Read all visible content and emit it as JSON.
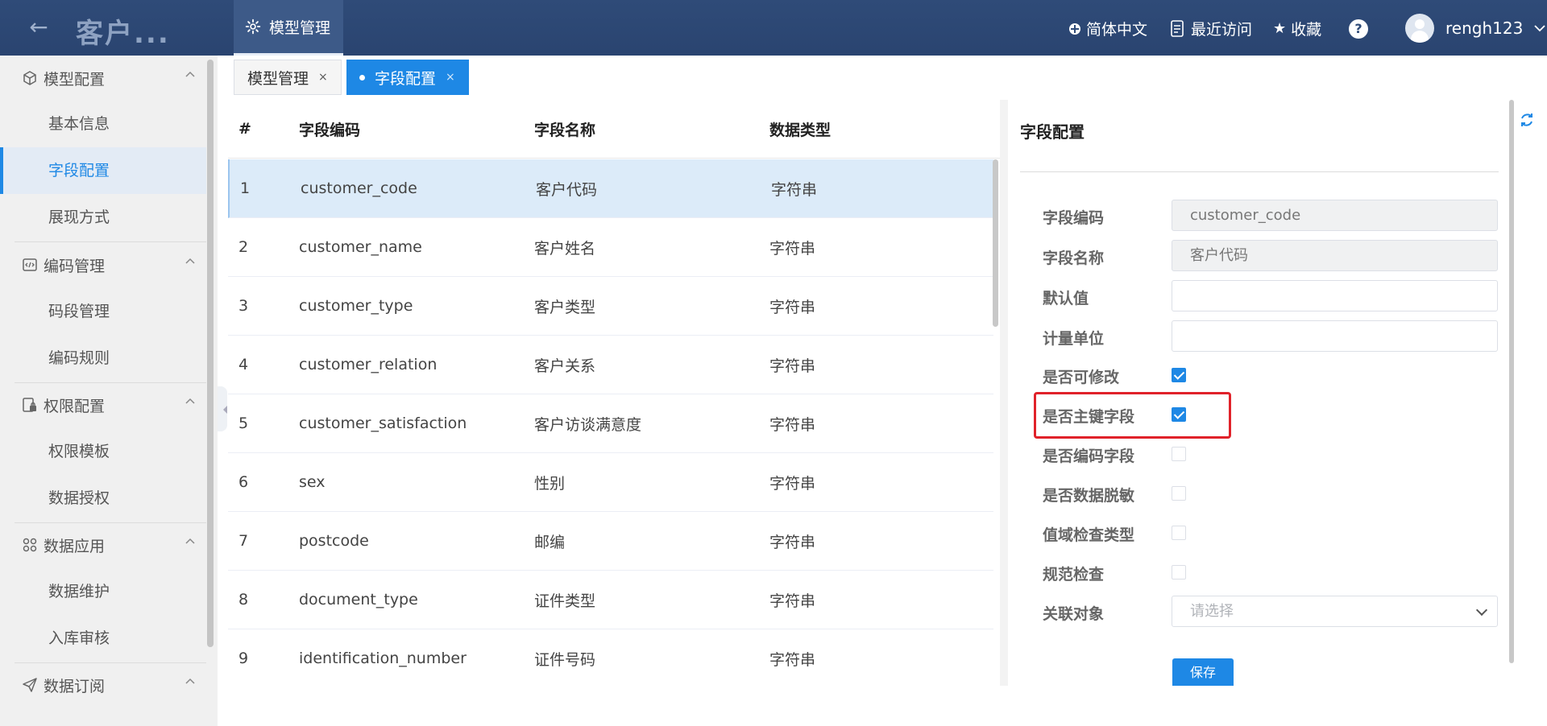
{
  "header": {
    "title": "客户...",
    "active_module": "模型管理",
    "language": "简体中文",
    "recent": "最近访问",
    "favorites": "收藏",
    "help": "?",
    "username": "rengh123"
  },
  "sidebar": {
    "groups": [
      {
        "label": "模型配置",
        "icon": "cube-icon",
        "items": [
          "基本信息",
          "字段配置",
          "展现方式"
        ]
      },
      {
        "label": "编码管理",
        "icon": "code-icon",
        "items": [
          "码段管理",
          "编码规则"
        ]
      },
      {
        "label": "权限配置",
        "icon": "lock-doc-icon",
        "items": [
          "权限模板",
          "数据授权"
        ]
      },
      {
        "label": "数据应用",
        "icon": "grid-apps-icon",
        "items": [
          "数据维护",
          "入库审核"
        ]
      },
      {
        "label": "数据订阅",
        "icon": "send-icon",
        "items": []
      }
    ],
    "active_item": "字段配置"
  },
  "tabs": [
    {
      "label": "模型管理",
      "close": "×",
      "active": false
    },
    {
      "label": "字段配置",
      "close": "×",
      "active": true
    }
  ],
  "table": {
    "columns": [
      "#",
      "字段编码",
      "字段名称",
      "数据类型"
    ],
    "rows": [
      [
        "1",
        "customer_code",
        "客户代码",
        "字符串"
      ],
      [
        "2",
        "customer_name",
        "客户姓名",
        "字符串"
      ],
      [
        "3",
        "customer_type",
        "客户类型",
        "字符串"
      ],
      [
        "4",
        "customer_relation",
        "客户关系",
        "字符串"
      ],
      [
        "5",
        "customer_satisfaction",
        "客户访谈满意度",
        "字符串"
      ],
      [
        "6",
        "sex",
        "性别",
        "字符串"
      ],
      [
        "7",
        "postcode",
        "邮编",
        "字符串"
      ],
      [
        "8",
        "document_type",
        "证件类型",
        "字符串"
      ],
      [
        "9",
        "identification_number",
        "证件号码",
        "字符串"
      ]
    ],
    "selected_row": 0
  },
  "form": {
    "title": "字段配置",
    "field_code": {
      "label": "字段编码",
      "value": "customer_code"
    },
    "field_name": {
      "label": "字段名称",
      "value": "客户代码"
    },
    "default_value": {
      "label": "默认值",
      "value": ""
    },
    "unit": {
      "label": "计量单位",
      "value": ""
    },
    "checks": [
      {
        "label": "是否可修改",
        "checked": true
      },
      {
        "label": "是否主键字段",
        "checked": true
      },
      {
        "label": "是否编码字段",
        "checked": false
      },
      {
        "label": "是否数据脱敏",
        "checked": false
      },
      {
        "label": "值域检查类型",
        "checked": false
      },
      {
        "label": "规范检查",
        "checked": false
      }
    ],
    "related_object": {
      "label": "关联对象",
      "placeholder": "请选择"
    },
    "save_label": "保存"
  },
  "colors": {
    "header_bg": "#2f4b78",
    "accent": "#1e88e5",
    "selected_row_bg": "#dcebf9",
    "highlight_border": "#e0222a"
  }
}
